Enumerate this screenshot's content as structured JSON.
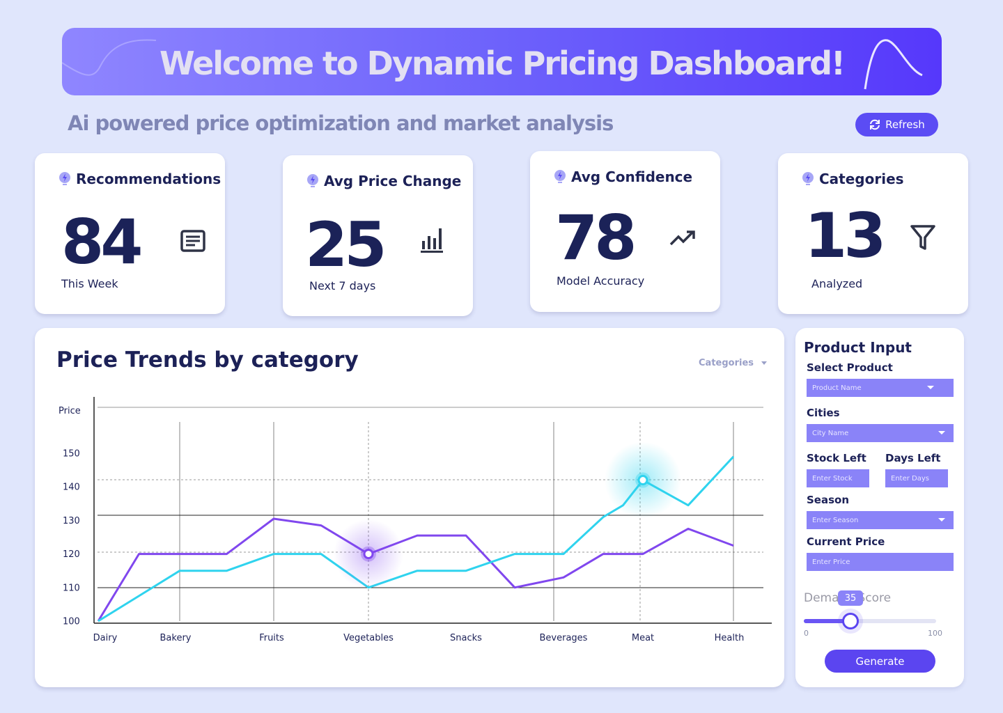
{
  "header": {
    "title": "Welcome to Dynamic Pricing Dashboard!",
    "subtitle": "Ai powered price optimization and market analysis",
    "refresh_label": "Refresh"
  },
  "stats": [
    {
      "title": "Recommendations",
      "value": "84",
      "note": "This Week",
      "icon": "document-icon"
    },
    {
      "title": "Avg Price Change",
      "value": "25",
      "note": "Next 7 days",
      "icon": "bar-chart-icon"
    },
    {
      "title": "Avg Confidence",
      "value": "78",
      "note": "Model Accuracy",
      "icon": "trending-up-icon"
    },
    {
      "title": "Categories",
      "value": "13",
      "note": "Analyzed",
      "icon": "filter-icon"
    }
  ],
  "trends": {
    "title": "Price Trends by category",
    "dropdown_label": "Categories"
  },
  "chart_data": {
    "type": "line",
    "ylabel": "Price",
    "xlabel": "",
    "ylim": [
      100,
      150
    ],
    "yticks": [
      100,
      110,
      120,
      130,
      140,
      150
    ],
    "categories": [
      "Dairy",
      "Bakery",
      "Fruits",
      "Vegetables",
      "Snacks",
      "Beverages",
      "Meat",
      "Health"
    ],
    "x": [
      0,
      0.5,
      1,
      1.5,
      2,
      2.5,
      3,
      3.5,
      4,
      4.5,
      5,
      5.5,
      5.75,
      6,
      6.5,
      7
    ],
    "series": [
      {
        "color": "#8047ee",
        "values": [
          100,
          120,
          120,
          120,
          130.5,
          128.5,
          120,
          125.5,
          125.5,
          110,
          113,
          120,
          120,
          120,
          127.5,
          122.5
        ],
        "highlight_index": 6
      },
      {
        "color": "#2fd3ee",
        "values": [
          100,
          107.5,
          115,
          115,
          120,
          120,
          110,
          115,
          115,
          120,
          120,
          131,
          134.5,
          142,
          134.5,
          149
        ],
        "highlight_index": 13
      }
    ],
    "grid": true
  },
  "product_input": {
    "title": "Product Input",
    "select_product_label": "Select Product",
    "product_placeholder": "Product Name",
    "cities_label": "Cities",
    "city_placeholder": "City Name",
    "stock_label": "Stock Left",
    "stock_placeholder": "Enter Stock",
    "days_label": "Days Left",
    "days_placeholder": "Enter Days",
    "season_label": "Season",
    "season_placeholder": "Enter Season",
    "price_label": "Current Price",
    "price_placeholder": "Enter Price",
    "slider_label": "Demand Score",
    "slider_value": "35",
    "slider_min": "0",
    "slider_max": "100",
    "generate_label": "Generate"
  },
  "colors": {
    "accent": "#5b4cf4",
    "field": "#8a83f8",
    "series_purple": "#8047ee",
    "series_cyan": "#2fd3ee",
    "text_dark": "#1c2157"
  }
}
